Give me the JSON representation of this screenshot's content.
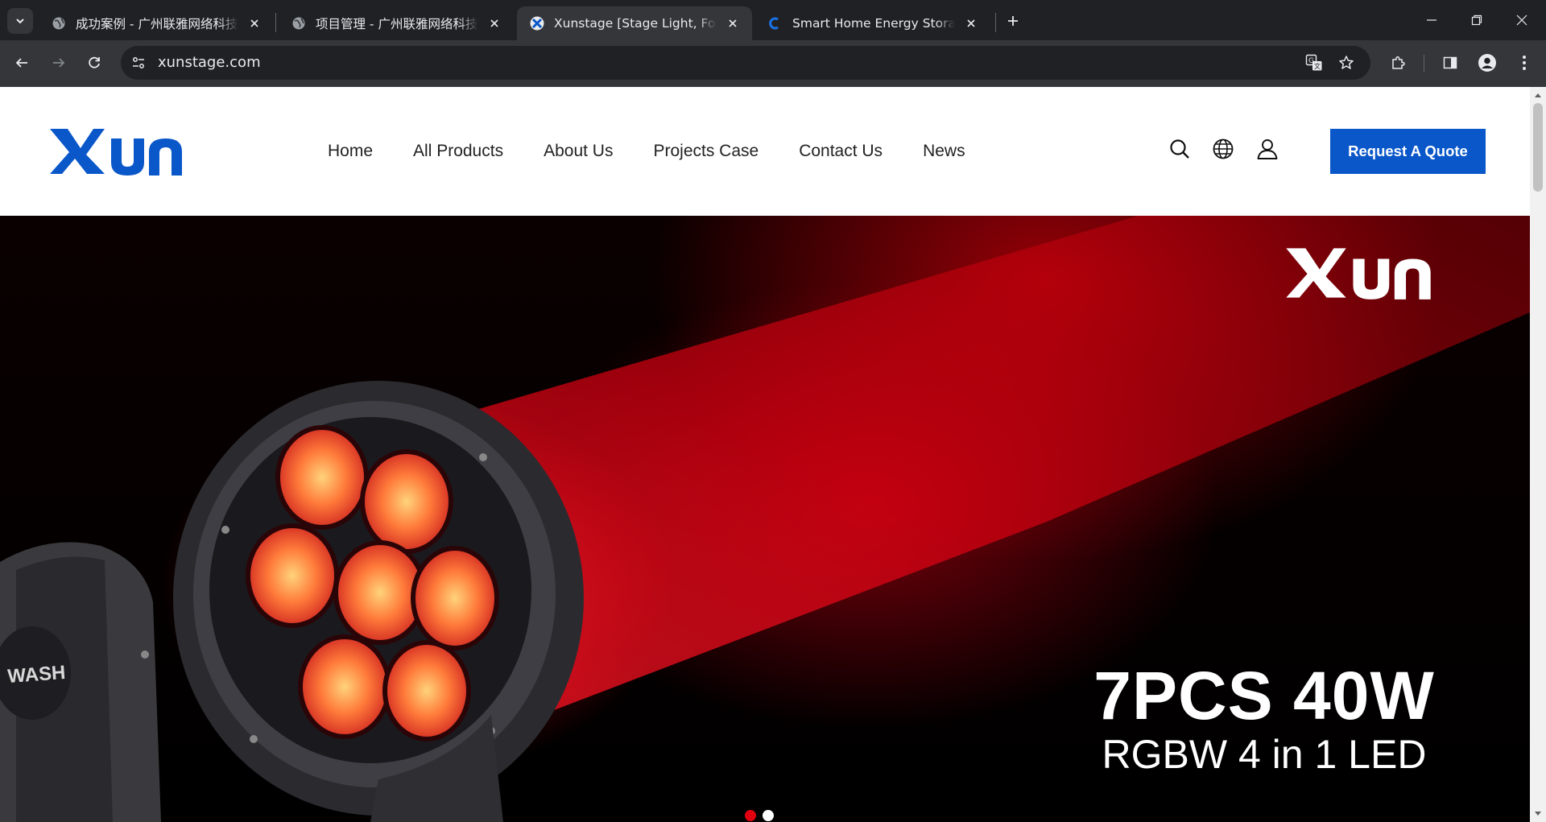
{
  "browser": {
    "tabs": [
      {
        "title": "成功案例 - 广州联雅网络科技有限公司",
        "favicon": "globe-icon",
        "active": false
      },
      {
        "title": "项目管理 - 广州联雅网络科技有限公司",
        "favicon": "globe-icon",
        "active": false
      },
      {
        "title": "Xunstage [Stage Light, Fog , Special Effects]",
        "favicon": "xun-favicon",
        "active": true
      },
      {
        "title": "Smart Home Energy Storage",
        "favicon": "c-favicon",
        "active": false
      }
    ],
    "address": "xunstage.com",
    "colors": {
      "frame": "#202124",
      "toolbar": "#35363a",
      "text": "#e8eaed"
    }
  },
  "site": {
    "logo_text": "XUN",
    "nav": [
      "Home",
      "All Products",
      "About Us",
      "Projects Case",
      "Contact Us",
      "News"
    ],
    "quote_button": "Request A Quote",
    "accent_color": "#0a57c9",
    "header_icons": [
      "search-icon",
      "globe-icon",
      "user-icon"
    ]
  },
  "hero": {
    "brand": "XUN",
    "headline": "7PCS 40W",
    "subline": "RGBW 4 in 1 LED",
    "fixture_label": "WASH",
    "slides": 2,
    "active_slide": 1,
    "beam_color": "#e60012"
  }
}
